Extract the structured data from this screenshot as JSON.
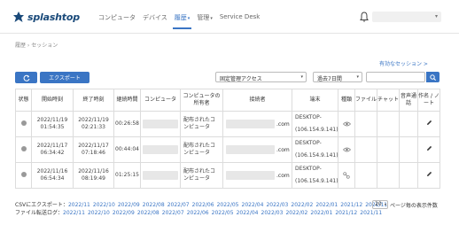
{
  "brand": {
    "name": "splashtop"
  },
  "nav": [
    {
      "label": "コンピュータ",
      "has_caret": false,
      "active": false
    },
    {
      "label": "デバイス",
      "has_caret": false,
      "active": false
    },
    {
      "label": "履歴",
      "has_caret": true,
      "active": true
    },
    {
      "label": "管理",
      "has_caret": true,
      "active": false
    },
    {
      "label": "Service Desk",
      "has_caret": false,
      "active": false
    }
  ],
  "breadcrumb": "履歴 › セッション",
  "new_session_link": "有効なセッション >",
  "toolbar": {
    "export_label": "エクスポート",
    "type_select": "固定管理アクセス",
    "range_select": "過去7日間",
    "search_placeholder": ""
  },
  "table": {
    "headers": [
      "状態",
      "開始時刻",
      "終了時刻",
      "継続時間",
      "コンピュータ",
      "コンピュータの所有者",
      "接続者",
      "端末",
      "種類",
      "ファイル",
      "チャット",
      "音声通話",
      "作名 / ノート"
    ],
    "rows": [
      {
        "start_date": "2022/11/19",
        "start_time": "01:54:35",
        "end_date": "2022/11/19",
        "end_time": "02:21:33",
        "duration": "00:26:58",
        "owner_1": "配布されたコ",
        "owner_2": "ンピュータ",
        "operator_domain": ".com",
        "terminal_name": "DESKTOP-",
        "terminal_ip": "(106.154.9.141)",
        "type_icon": "eye-icon"
      },
      {
        "start_date": "2022/11/17",
        "start_time": "06:34:42",
        "end_date": "2022/11/17",
        "end_time": "07:18:46",
        "duration": "00:44:04",
        "owner_1": "配布されたコ",
        "owner_2": "ンピュータ",
        "operator_domain": ".com",
        "terminal_name": "DESKTOP-",
        "terminal_ip": "(106.154.9.141)",
        "type_icon": "eye-icon"
      },
      {
        "start_date": "2022/11/16",
        "start_time": "06:54:34",
        "end_date": "2022/11/16",
        "end_time": "08:19:49",
        "duration": "01:25:15",
        "owner_1": "配布されたコ",
        "owner_2": "ンピュータ",
        "operator_domain": ".com",
        "terminal_name": "DESKTOP-",
        "terminal_ip": "(106.154.9.141)",
        "type_icon": "transfer-icon"
      }
    ]
  },
  "csv_export": {
    "label": "CSVにエクスポート：",
    "months": [
      "2022/11",
      "2022/10",
      "2022/09",
      "2022/08",
      "2022/07",
      "2022/06",
      "2022/05",
      "2022/04",
      "2022/03",
      "2022/02",
      "2022/01",
      "2021/12",
      "2021/11"
    ]
  },
  "file_transfer_log": {
    "label": "ファイル転送ログ：",
    "months": [
      "2022/11",
      "2022/10",
      "2022/09",
      "2022/08",
      "2022/07",
      "2022/06",
      "2022/05",
      "2022/04",
      "2022/03",
      "2022/02",
      "2022/01",
      "2021/12",
      "2021/11"
    ]
  },
  "per_page": {
    "value": "20",
    "label": "ページ毎の表示件数"
  },
  "colors": {
    "accent": "#3a75c4",
    "brand": "#1a4a7a",
    "status_dot": "#999999"
  }
}
